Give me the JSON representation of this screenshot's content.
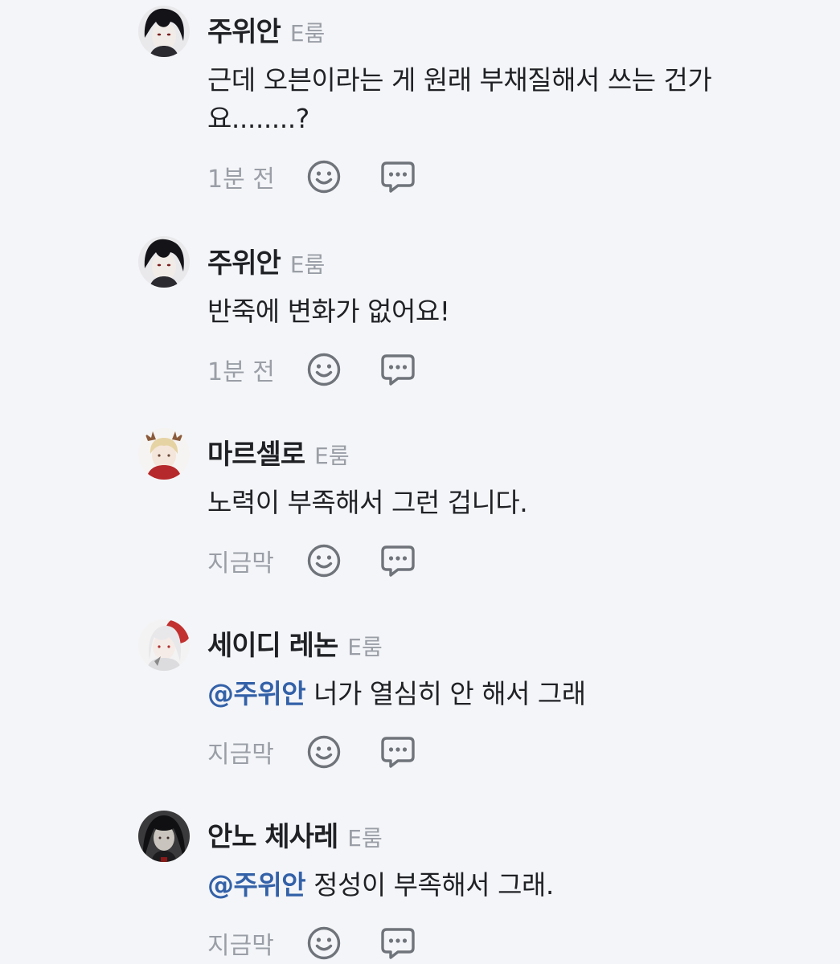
{
  "comments": [
    {
      "author": "주위안",
      "room": "E룸",
      "mention": "",
      "text": "근데 오븐이라는 게 원래 부채질해서 쓰는 건가요........?",
      "time": "1분 전"
    },
    {
      "author": "주위안",
      "room": "E룸",
      "mention": "",
      "text": "반죽에 변화가 없어요!",
      "time": "1분 전"
    },
    {
      "author": "마르셀로",
      "room": "E룸",
      "mention": "",
      "text": "노력이 부족해서 그런 겁니다.",
      "time": "지금막"
    },
    {
      "author": "세이디 레논",
      "room": "E룸",
      "mention": "@주위안",
      "text": "너가 열심히 안 해서 그래",
      "time": "지금막"
    },
    {
      "author": "안노 체사레",
      "room": "E룸",
      "mention": "@주위안",
      "text": "정성이 부족해서 그래.",
      "time": "지금막"
    }
  ],
  "icons": {
    "react": "smiley-face-icon",
    "reply": "speech-bubble-icon"
  },
  "colors": {
    "background": "#f4f5f8",
    "text": "#1f2125",
    "muted": "#9a9ea6",
    "mention": "#3361a8",
    "icon": "#6f737a"
  }
}
